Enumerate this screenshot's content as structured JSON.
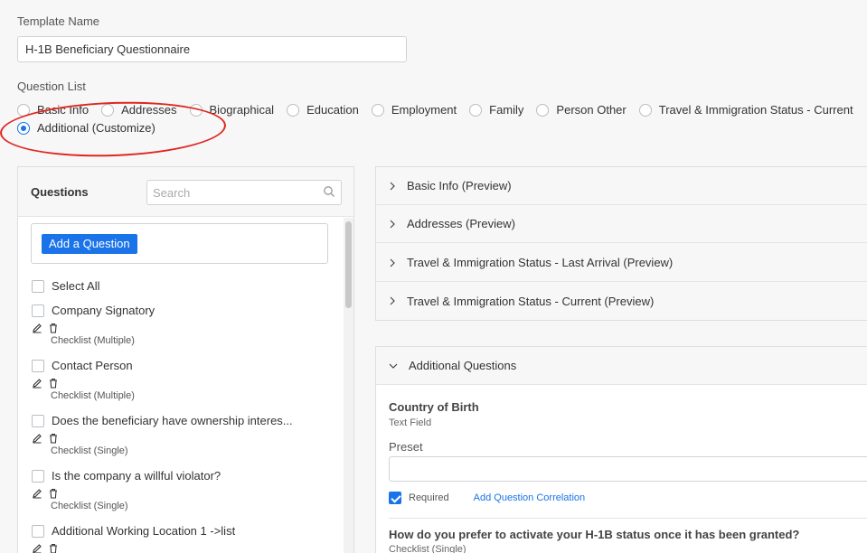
{
  "template": {
    "label": "Template Name",
    "value": "H-1B Beneficiary Questionnaire"
  },
  "question_list": {
    "label": "Question List",
    "options": [
      {
        "label": "Basic Info",
        "selected": false
      },
      {
        "label": "Addresses",
        "selected": false
      },
      {
        "label": "Biographical",
        "selected": false
      },
      {
        "label": "Education",
        "selected": false
      },
      {
        "label": "Employment",
        "selected": false
      },
      {
        "label": "Family",
        "selected": false
      },
      {
        "label": "Person Other",
        "selected": false
      },
      {
        "label": "Travel & Immigration Status - Current",
        "selected": false
      },
      {
        "label": "Additional (Customize)",
        "selected": true
      }
    ]
  },
  "questions_panel": {
    "title": "Questions",
    "search_placeholder": "Search",
    "add_button": "Add a Question",
    "select_all": "Select All",
    "items": [
      {
        "label": "Company Signatory",
        "type": "Checklist (Multiple)"
      },
      {
        "label": "Contact Person",
        "type": "Checklist (Multiple)"
      },
      {
        "label": "Does the beneficiary have ownership interes...",
        "type": "Checklist (Single)"
      },
      {
        "label": "Is the company a willful violator?",
        "type": "Checklist (Single)"
      },
      {
        "label": "Additional Working Location 1 ->list",
        "type": ""
      }
    ]
  },
  "preview_sections": [
    {
      "label": "Basic Info (Preview)"
    },
    {
      "label": "Addresses (Preview)"
    },
    {
      "label": "Travel & Immigration Status - Last Arrival (Preview)"
    },
    {
      "label": "Travel & Immigration Status - Current (Preview)"
    }
  ],
  "additional": {
    "header": "Additional Questions",
    "q1_title": "Country of Birth",
    "q1_type": "Text Field",
    "preset_label": "Preset",
    "preset_value": "",
    "required_label": "Required",
    "required_checked": true,
    "correlation_link": "Add Question Correlation",
    "q2_title": "How do you prefer to activate your H-1B status once it has been granted?",
    "q2_type": "Checklist (Single)"
  },
  "colors": {
    "accent": "#1a73e8",
    "highlight_oval": "#e0261f"
  }
}
